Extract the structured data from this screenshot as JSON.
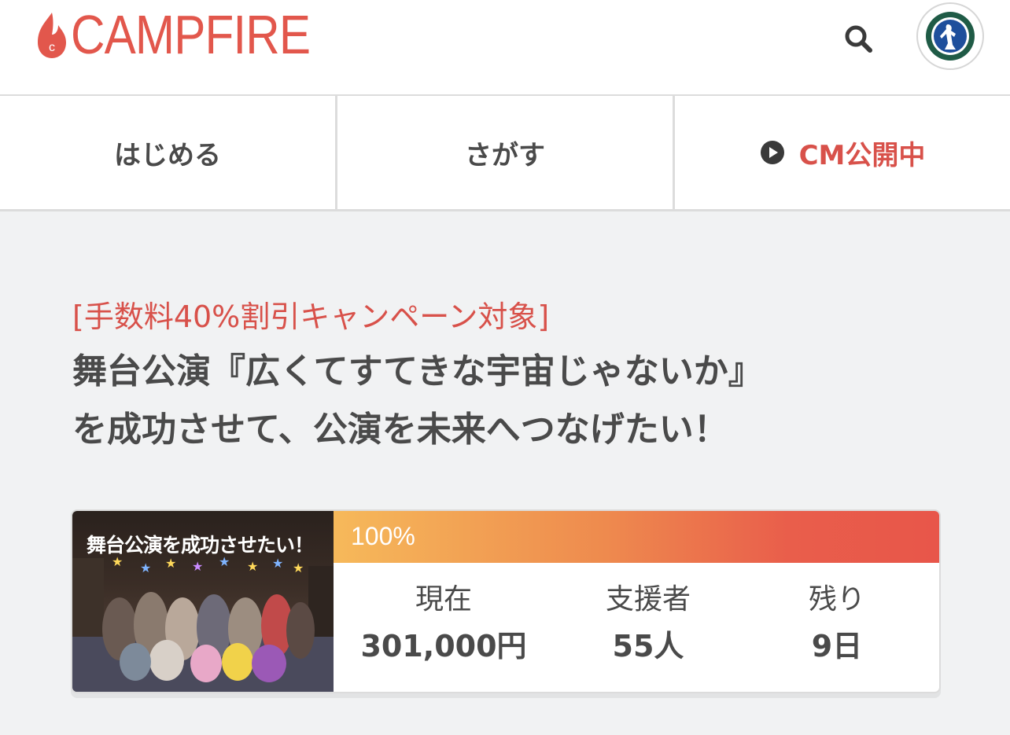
{
  "header": {
    "logo_text": "CAMPFIRE",
    "logo_mark_letter": "c",
    "brand_color": "#e2574c",
    "search_icon": "search-icon",
    "avatar_icon": "user-avatar-icon"
  },
  "nav": {
    "items": [
      {
        "label": "はじめる"
      },
      {
        "label": "さがす"
      },
      {
        "label": "CM公開中",
        "icon": "play-circle-icon",
        "color": "#d8514a"
      }
    ]
  },
  "project": {
    "campaign_tag": "[手数料40%割引キャンペーン対象]",
    "title_line1": "舞台公演『広くてすてきな宇宙じゃないか』",
    "title_line2": "を成功させて、公演を未来へつなげたい！",
    "thumbnail_caption": "舞台公演を成功させたい！"
  },
  "funding": {
    "progress_label": "100%",
    "progress_fraction": 1.0,
    "stats": [
      {
        "label": "現在",
        "value": "301,000円"
      },
      {
        "label": "支援者",
        "value": "55人"
      },
      {
        "label": "残り",
        "value": "9日"
      }
    ]
  }
}
